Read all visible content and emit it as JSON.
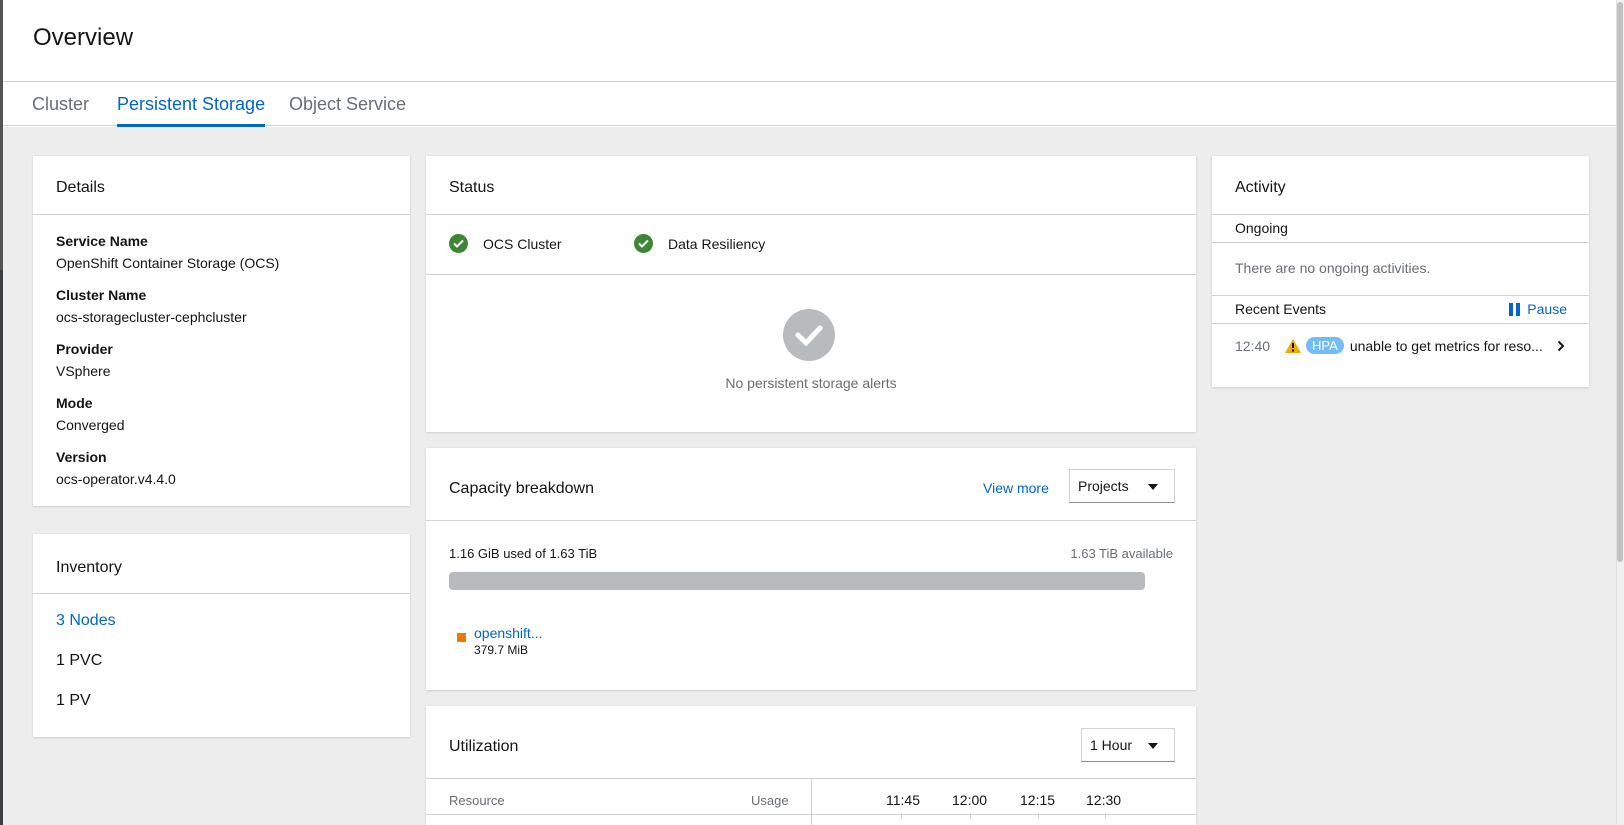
{
  "page": {
    "title": "Overview"
  },
  "tabs": [
    {
      "label": "Cluster",
      "active": false
    },
    {
      "label": "Persistent Storage",
      "active": true
    },
    {
      "label": "Object Service",
      "active": false
    }
  ],
  "details": {
    "title": "Details",
    "items": [
      {
        "term": "Service Name",
        "value": "OpenShift Container Storage (OCS)"
      },
      {
        "term": "Cluster Name",
        "value": "ocs-storagecluster-cephcluster"
      },
      {
        "term": "Provider",
        "value": "VSphere"
      },
      {
        "term": "Mode",
        "value": "Converged"
      },
      {
        "term": "Version",
        "value": "ocs-operator.v4.4.0"
      }
    ]
  },
  "inventory": {
    "title": "Inventory",
    "items": [
      {
        "label": "3 Nodes",
        "link": true
      },
      {
        "label": "1 PVC",
        "link": false
      },
      {
        "label": "1 PV",
        "link": false
      }
    ]
  },
  "status": {
    "title": "Status",
    "items": [
      {
        "label": "OCS Cluster",
        "state": "healthy"
      },
      {
        "label": "Data Resiliency",
        "state": "healthy"
      }
    ],
    "empty_message": "No persistent storage alerts"
  },
  "capacity": {
    "title": "Capacity breakdown",
    "view_more": "View more",
    "dropdown_value": "Projects",
    "used_text": "1.16 GiB used of 1.63 TiB",
    "available_text": "1.63 TiB available",
    "legend": {
      "name": "openshift...",
      "value": "379.7 MiB",
      "color": "#ec7a08"
    }
  },
  "utilization": {
    "title": "Utilization",
    "dropdown_value": "1 Hour",
    "col_resource": "Resource",
    "col_usage": "Usage",
    "times": [
      "11:45",
      "12:00",
      "12:15",
      "12:30"
    ]
  },
  "activity": {
    "title": "Activity",
    "ongoing_label": "Ongoing",
    "ongoing_empty": "There are no ongoing activities.",
    "recent_label": "Recent Events",
    "pause_label": "Pause",
    "event": {
      "time": "12:40",
      "badge": "HPA",
      "message": "unable to get metrics for reso..."
    }
  },
  "colors": {
    "accent": "#0066cc",
    "success": "#3e8635",
    "warning": "#f0ab00",
    "badge": "#73bcf7"
  }
}
